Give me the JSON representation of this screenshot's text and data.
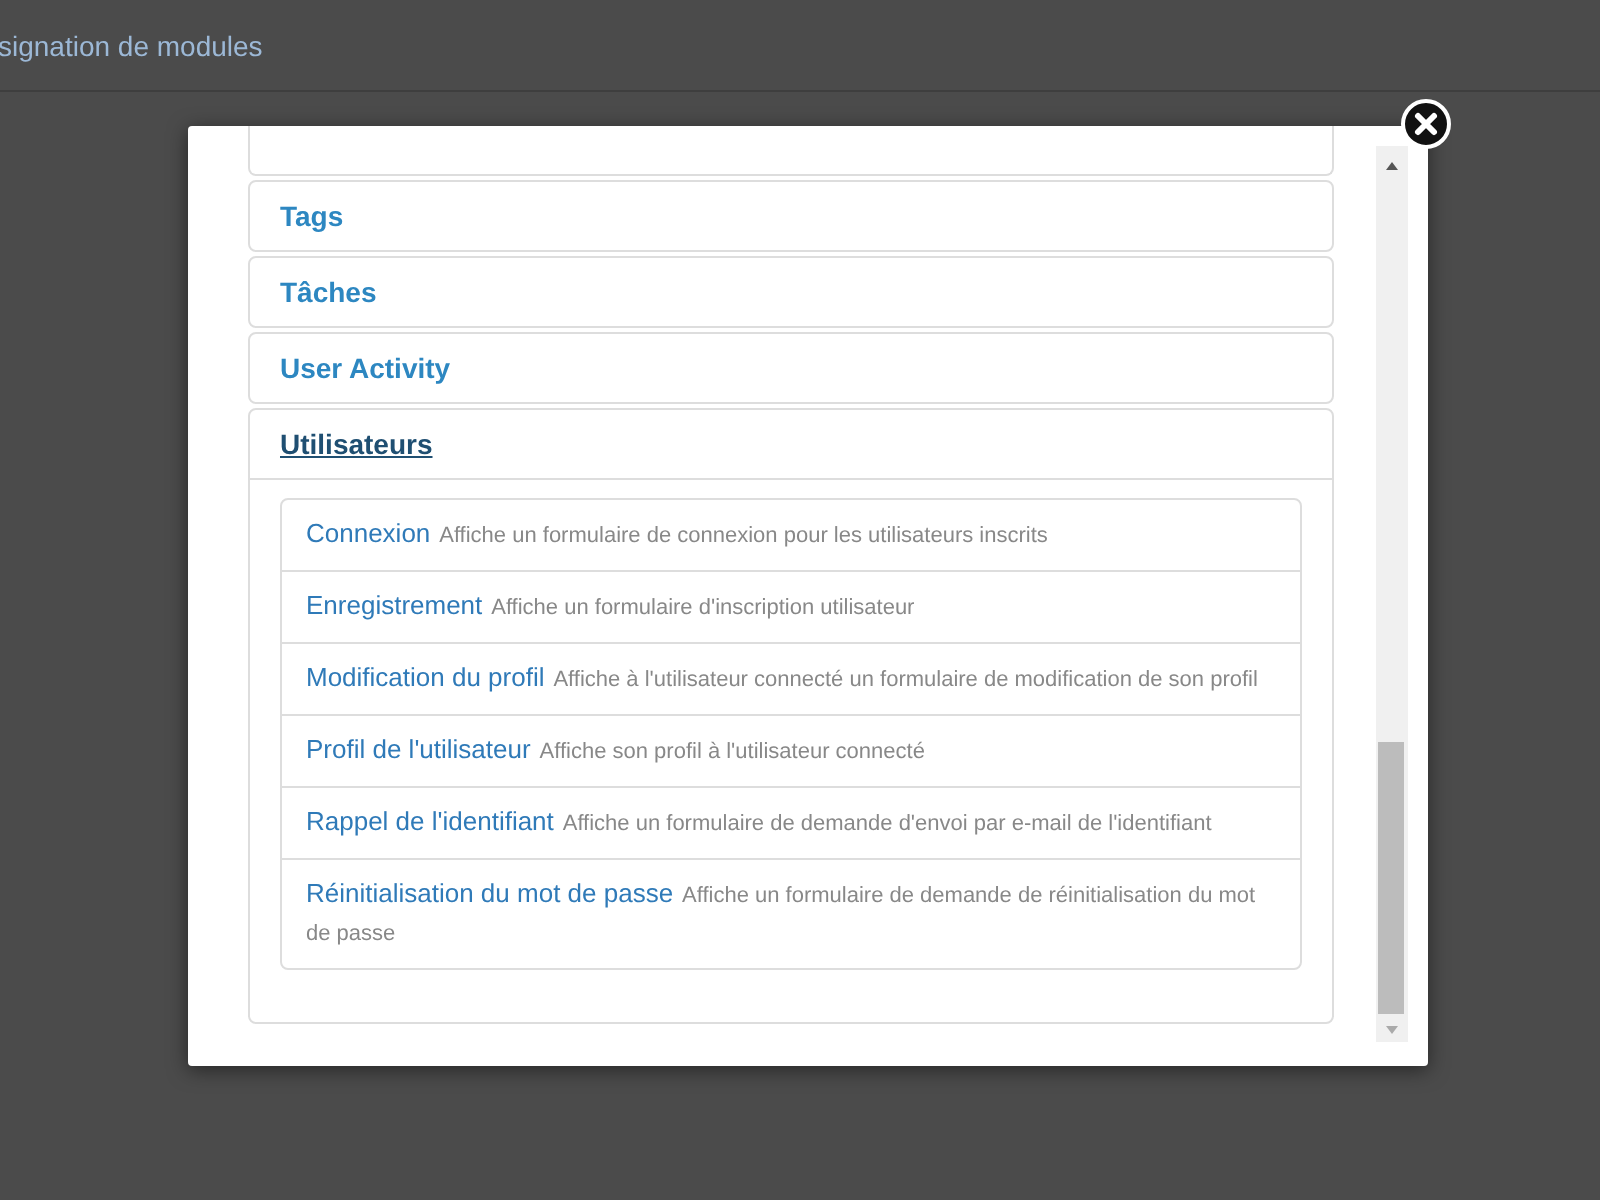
{
  "background_page": {
    "title": "signation de modules"
  },
  "modal": {
    "panels": [
      {
        "title": "Tags",
        "expanded": false
      },
      {
        "title": "Tâches",
        "expanded": false
      },
      {
        "title": "User Activity",
        "expanded": false
      },
      {
        "title": "Utilisateurs",
        "expanded": true,
        "items": [
          {
            "name": "Connexion",
            "description": "Affiche un formulaire de connexion pour les utilisateurs inscrits"
          },
          {
            "name": "Enregistrement",
            "description": "Affiche un formulaire d'inscription utilisateur"
          },
          {
            "name": "Modification du profil",
            "description": "Affiche à l'utilisateur connecté un formulaire de modification de son profil"
          },
          {
            "name": "Profil de l'utilisateur",
            "description": "Affiche son profil à l'utilisateur connecté"
          },
          {
            "name": "Rappel de l'identifiant",
            "description": "Affiche un formulaire de demande d'envoi par e-mail de l'identifiant"
          },
          {
            "name": "Réinitialisation du mot de passe",
            "description": "Affiche un formulaire de demande de réinitialisation du mot de passe"
          }
        ]
      }
    ]
  }
}
